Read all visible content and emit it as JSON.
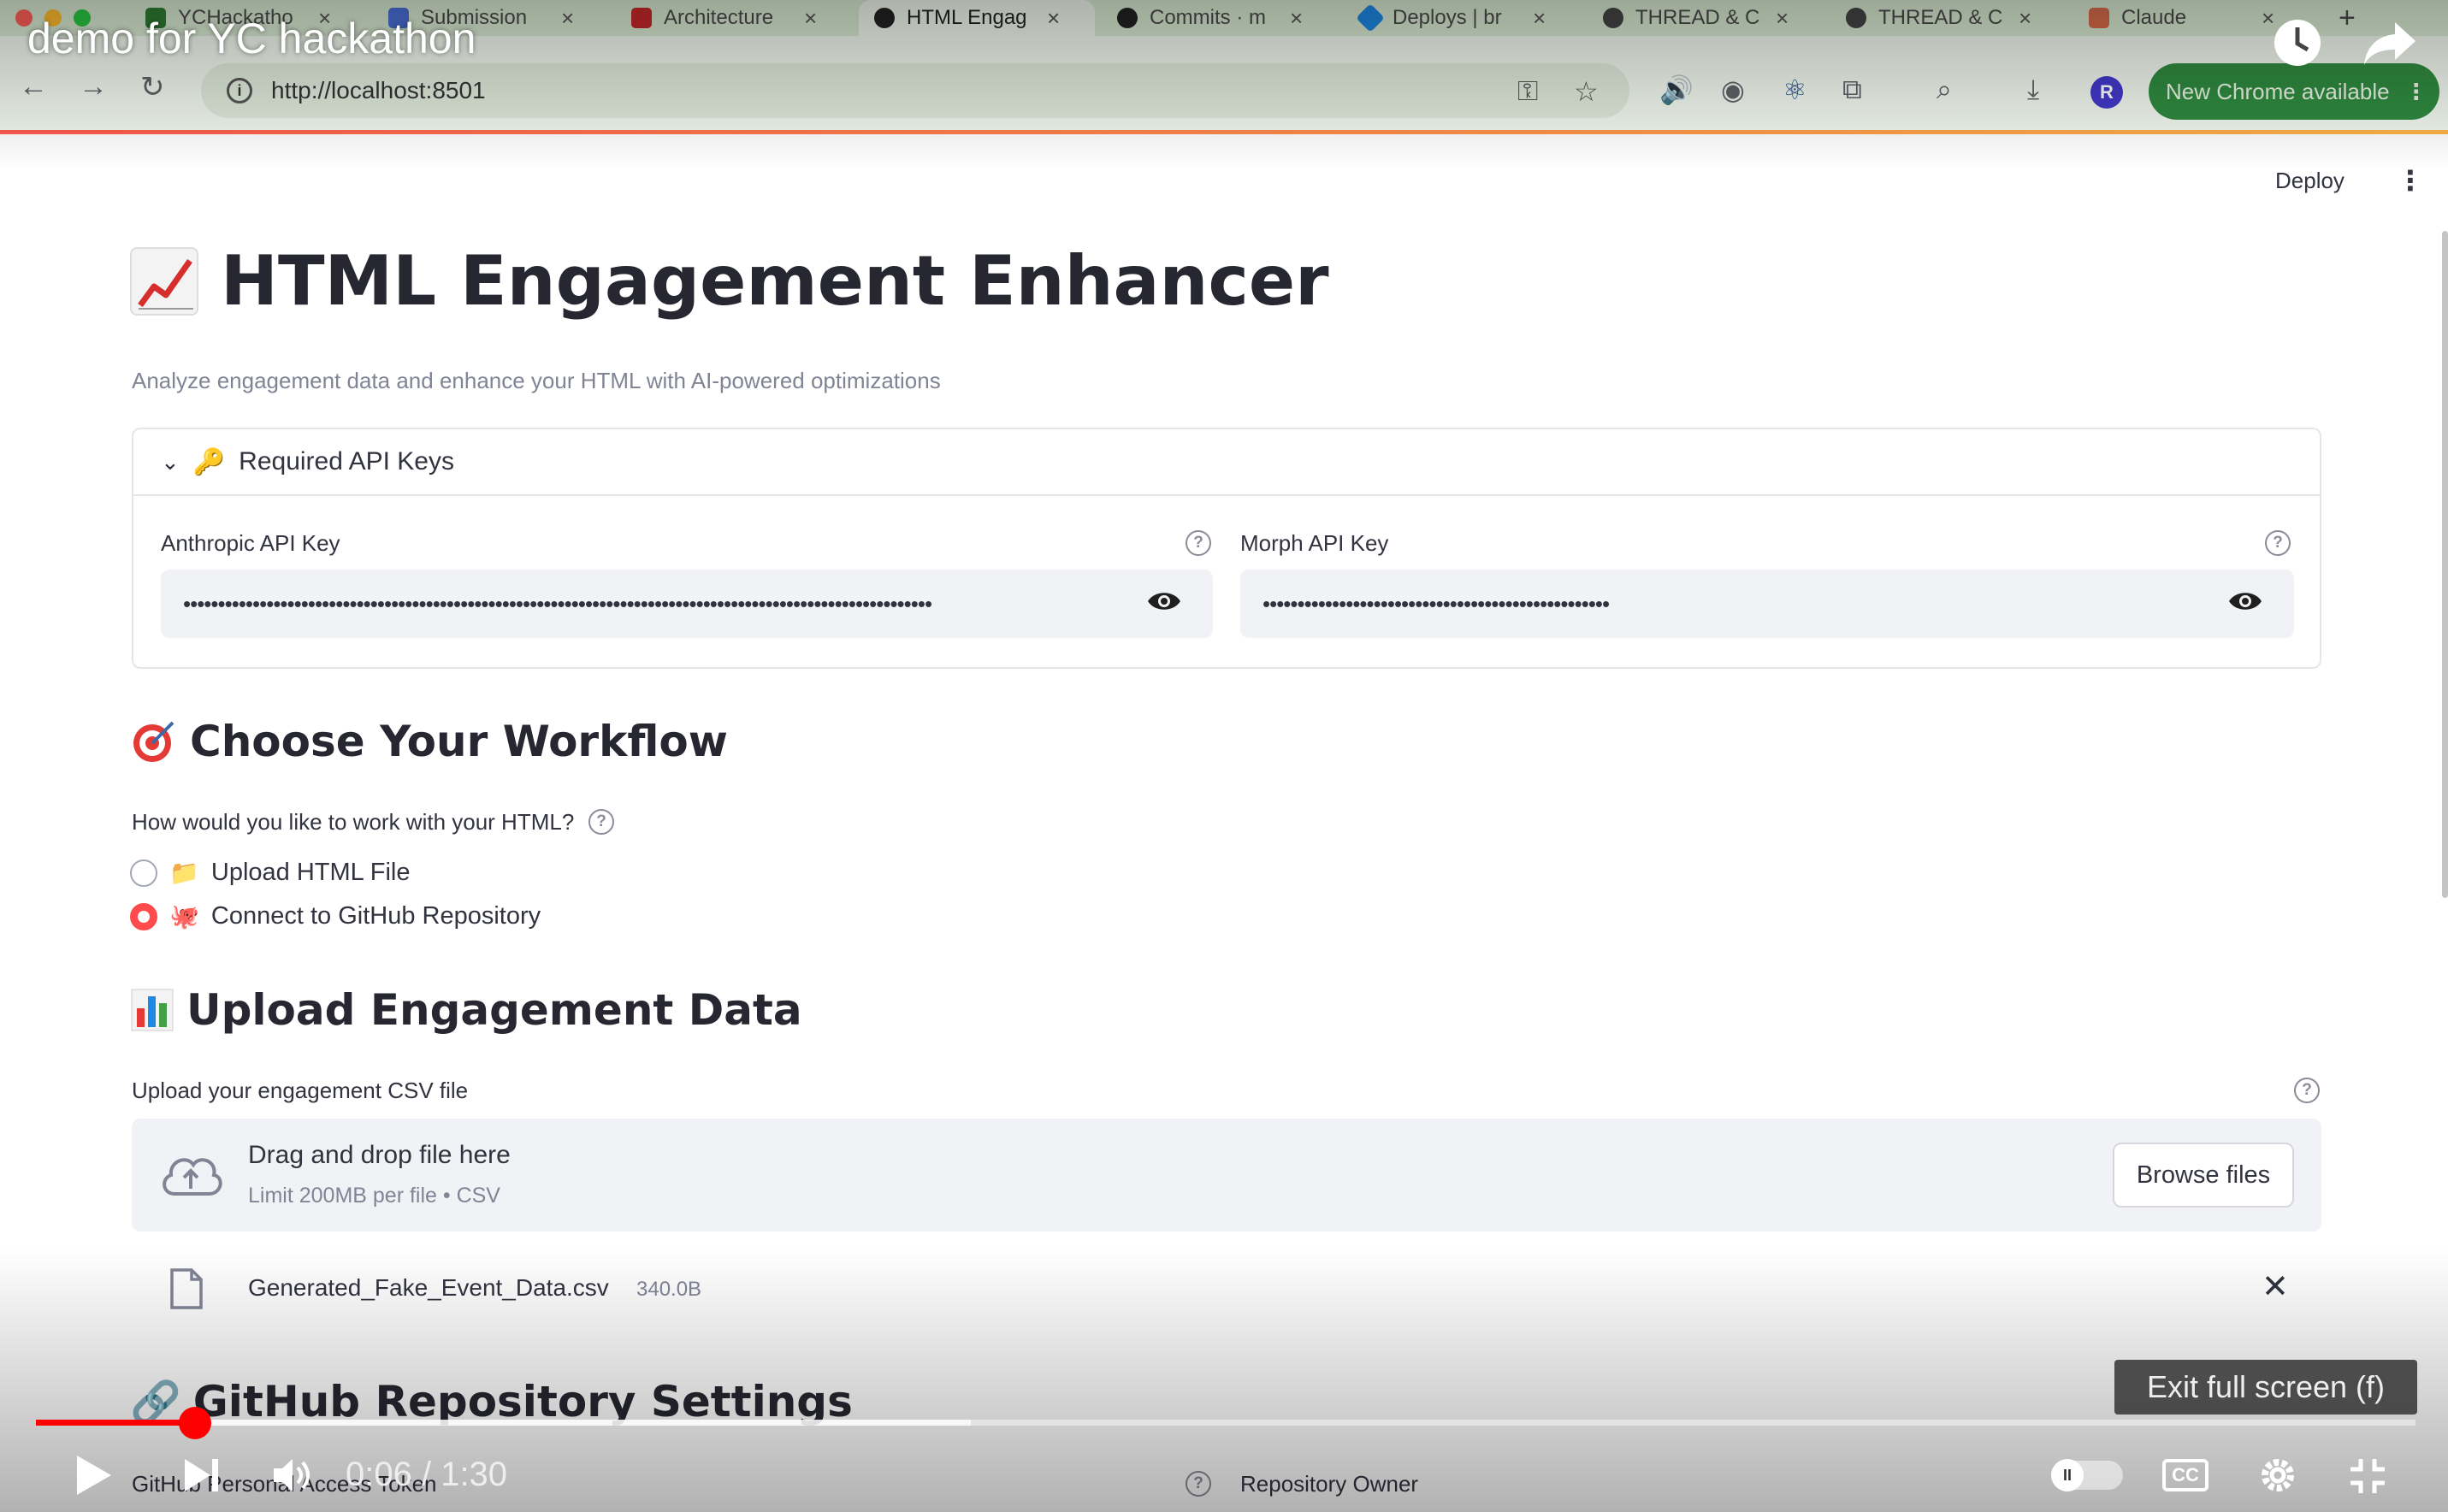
{
  "browser": {
    "tabs": [
      {
        "label": "YCHackatho",
        "color": "#2e7d32"
      },
      {
        "label": "Submission",
        "color": "#4a6fd8"
      },
      {
        "label": "Architecture",
        "color": "#c62828"
      },
      {
        "label": "HTML Engag",
        "color": "#222222",
        "active": true
      },
      {
        "label": "Commits · m",
        "color": "#222222"
      },
      {
        "label": "Deploys | br",
        "color": "#1e88e5"
      },
      {
        "label": "THREAD & C",
        "color": "#444444"
      },
      {
        "label": "THREAD & C",
        "color": "#444444"
      },
      {
        "label": "Claude",
        "color": "#d86b4a"
      }
    ],
    "url": "http://localhost:8501",
    "profile_initial": "R",
    "new_chrome_label": "New Chrome available"
  },
  "app": {
    "deploy_label": "Deploy",
    "title": "HTML Engagement Enhancer",
    "subtitle": "Analyze engagement data and enhance your HTML with AI-powered optimizations",
    "api_keys": {
      "expander_label": "Required API Keys",
      "anthropic_label": "Anthropic API Key",
      "anthropic_value": "••••••••••••••••••••••••••••••••••••••••••••••••••••••••••••••••••••••••••••••••••••••••••••••••••••••••••••",
      "morph_label": "Morph API Key",
      "morph_value": "••••••••••••••••••••••••••••••••••••••••••••••••••"
    },
    "workflow": {
      "heading": "Choose Your Workflow",
      "question": "How would you like to work with your HTML?",
      "options": [
        {
          "label": "Upload HTML File",
          "selected": false
        },
        {
          "label": "Connect to GitHub Repository",
          "selected": true
        }
      ]
    },
    "upload": {
      "heading": "Upload Engagement Data",
      "label": "Upload your engagement CSV file",
      "dropzone_title": "Drag and drop file here",
      "dropzone_limit": "Limit 200MB per file • CSV",
      "browse_label": "Browse files",
      "file_name": "Generated_Fake_Event_Data.csv",
      "file_size": "340.0B"
    },
    "github": {
      "heading": "GitHub Repository Settings",
      "pat_label": "GitHub Personal Access Token",
      "owner_label": "Repository Owner"
    }
  },
  "video": {
    "title": "demo for YC hackathon",
    "exit_fullscreen_label": "Exit full screen (f)",
    "time": "0:06 / 1:30",
    "progress_fraction": 0.067,
    "buffered_fraction": 0.393,
    "accent_color": "#ff0000"
  }
}
